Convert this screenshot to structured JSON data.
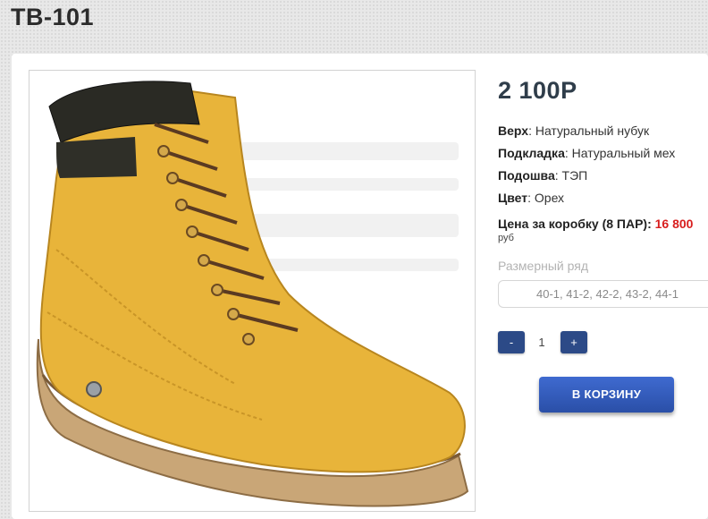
{
  "page": {
    "title": "TB-101"
  },
  "product": {
    "price": "2 100Р",
    "specs": [
      {
        "label": "Верх",
        "value": ": Натуральный нубук"
      },
      {
        "label": "Подкладка",
        "value": ": Натуральный мех"
      },
      {
        "label": "Подошва",
        "value": ": ТЭП"
      },
      {
        "label": "Цвет",
        "value": ": Орех"
      }
    ],
    "box_price": {
      "label": "Цена за коробку (8 ПАР): ",
      "value": "16 800",
      "currency": "руб"
    },
    "size_range": {
      "label": "Размерный ряд",
      "value": "40-1, 41-2, 42-2, 43-2, 44-1"
    },
    "quantity": {
      "minus": "-",
      "value": "1",
      "plus": "+"
    },
    "cart_button": "В КОРЗИНУ",
    "image": {
      "alt_icon": "boot-icon"
    }
  },
  "colors": {
    "accent": "#2c4a87",
    "price_red": "#d81e1e",
    "boot": "#e8b43a"
  }
}
